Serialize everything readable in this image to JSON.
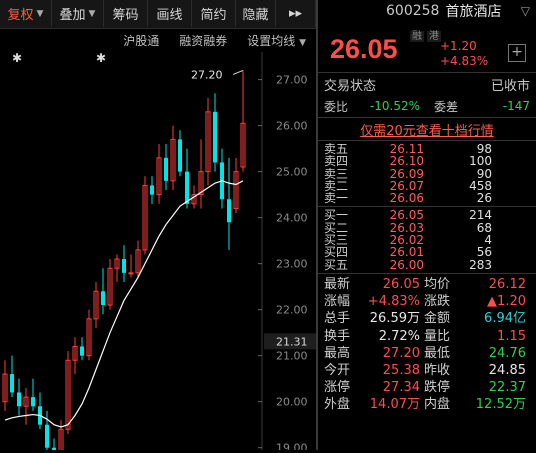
{
  "toolbar": {
    "items": [
      {
        "label": "复权",
        "dropdown": true,
        "active": true
      },
      {
        "label": "叠加",
        "dropdown": true
      },
      {
        "label": "筹码"
      },
      {
        "label": "画线"
      },
      {
        "label": "简约"
      },
      {
        "label": "隐藏"
      },
      {
        "label": "▸▸"
      }
    ]
  },
  "subtoolbar": {
    "hgt": "沪股通",
    "margin": "融资融券",
    "ma": "设置均线"
  },
  "chart": {
    "markers": [
      "✱",
      "✱"
    ],
    "high_label": "27.20",
    "current_tag": "21.31",
    "axis_labels": [
      "27.00",
      "26.00",
      "25.00",
      "24.00",
      "23.00",
      "22.00",
      "21.00",
      "20.00",
      "19.00"
    ],
    "candles": [
      {
        "o": 20.0,
        "h": 20.9,
        "l": 19.8,
        "c": 20.6
      },
      {
        "o": 20.6,
        "h": 21.0,
        "l": 20.1,
        "c": 20.2
      },
      {
        "o": 20.2,
        "h": 20.5,
        "l": 19.7,
        "c": 19.9
      },
      {
        "o": 19.9,
        "h": 20.3,
        "l": 19.5,
        "c": 20.1
      },
      {
        "o": 20.1,
        "h": 20.5,
        "l": 19.8,
        "c": 19.9
      },
      {
        "o": 19.9,
        "h": 20.2,
        "l": 19.4,
        "c": 19.5
      },
      {
        "o": 19.5,
        "h": 19.8,
        "l": 18.8,
        "c": 19.0
      },
      {
        "o": 19.0,
        "h": 19.2,
        "l": 18.7,
        "c": 18.9
      },
      {
        "o": 18.9,
        "h": 19.6,
        "l": 18.8,
        "c": 19.4
      },
      {
        "o": 19.4,
        "h": 21.1,
        "l": 19.3,
        "c": 20.9
      },
      {
        "o": 20.9,
        "h": 21.4,
        "l": 20.6,
        "c": 21.2
      },
      {
        "o": 21.2,
        "h": 21.4,
        "l": 20.9,
        "c": 21.0
      },
      {
        "o": 21.0,
        "h": 22.0,
        "l": 20.9,
        "c": 21.8
      },
      {
        "o": 21.8,
        "h": 22.6,
        "l": 21.6,
        "c": 22.4
      },
      {
        "o": 22.4,
        "h": 22.9,
        "l": 21.9,
        "c": 22.1
      },
      {
        "o": 22.1,
        "h": 23.1,
        "l": 22.0,
        "c": 22.9
      },
      {
        "o": 22.9,
        "h": 23.2,
        "l": 22.6,
        "c": 23.1
      },
      {
        "o": 23.1,
        "h": 23.4,
        "l": 22.6,
        "c": 22.8
      },
      {
        "o": 22.8,
        "h": 23.2,
        "l": 22.7,
        "c": 22.8
      },
      {
        "o": 22.8,
        "h": 23.5,
        "l": 22.7,
        "c": 23.3
      },
      {
        "o": 23.3,
        "h": 24.9,
        "l": 23.2,
        "c": 24.7
      },
      {
        "o": 24.7,
        "h": 24.9,
        "l": 24.3,
        "c": 24.5
      },
      {
        "o": 24.5,
        "h": 25.6,
        "l": 24.3,
        "c": 25.3
      },
      {
        "o": 25.3,
        "h": 25.6,
        "l": 24.6,
        "c": 24.8
      },
      {
        "o": 24.8,
        "h": 26.0,
        "l": 24.6,
        "c": 25.7
      },
      {
        "o": 25.7,
        "h": 25.9,
        "l": 24.9,
        "c": 25.0
      },
      {
        "o": 25.0,
        "h": 25.5,
        "l": 24.2,
        "c": 24.3
      },
      {
        "o": 24.3,
        "h": 24.7,
        "l": 24.2,
        "c": 24.5
      },
      {
        "o": 24.5,
        "h": 25.7,
        "l": 24.2,
        "c": 25.0
      },
      {
        "o": 25.0,
        "h": 26.6,
        "l": 24.7,
        "c": 26.3
      },
      {
        "o": 26.3,
        "h": 26.7,
        "l": 25.0,
        "c": 25.2
      },
      {
        "o": 25.2,
        "h": 25.5,
        "l": 24.2,
        "c": 24.4
      },
      {
        "o": 24.4,
        "h": 25.3,
        "l": 23.3,
        "c": 23.9
      },
      {
        "o": 24.2,
        "h": 25.3,
        "l": 24.1,
        "c": 25.0
      },
      {
        "o": 25.1,
        "h": 27.2,
        "l": 25.0,
        "c": 26.05
      }
    ],
    "ma": [
      19.6,
      19.65,
      19.68,
      19.7,
      19.72,
      19.7,
      19.62,
      19.5,
      19.45,
      19.5,
      19.7,
      19.95,
      20.3,
      20.7,
      21.1,
      21.5,
      21.85,
      22.2,
      22.45,
      22.7,
      23.0,
      23.3,
      23.6,
      23.85,
      24.05,
      24.25,
      24.35,
      24.45,
      24.55,
      24.65,
      24.75,
      24.8,
      24.75,
      24.72,
      24.8
    ]
  },
  "quote": {
    "code": "600258",
    "name": "首旅酒店",
    "price": "26.05",
    "change": "+1.20",
    "pct": "+4.83%",
    "tags": [
      "融",
      "港"
    ],
    "status_label": "交易状态",
    "status_value": "已收市",
    "weibi_label": "委比",
    "weibi_value": "-10.52%",
    "weicha_label": "委差",
    "weicha_value": "-147",
    "promo": "仅需20元查看十档行情"
  },
  "asks": [
    {
      "label": "卖五",
      "price": "26.11",
      "vol": "98"
    },
    {
      "label": "卖四",
      "price": "26.10",
      "vol": "100"
    },
    {
      "label": "卖三",
      "price": "26.09",
      "vol": "90"
    },
    {
      "label": "卖二",
      "price": "26.07",
      "vol": "458"
    },
    {
      "label": "卖一",
      "price": "26.06",
      "vol": "26"
    }
  ],
  "bids": [
    {
      "label": "买一",
      "price": "26.05",
      "vol": "214"
    },
    {
      "label": "买二",
      "price": "26.03",
      "vol": "68"
    },
    {
      "label": "买三",
      "price": "26.02",
      "vol": "4"
    },
    {
      "label": "买四",
      "price": "26.01",
      "vol": "56"
    },
    {
      "label": "买五",
      "price": "26.00",
      "vol": "283"
    }
  ],
  "stats": [
    {
      "l1": "最新",
      "v1": "26.05",
      "c1": "red",
      "l2": "均价",
      "v2": "26.12",
      "c2": "red"
    },
    {
      "l1": "涨幅",
      "v1": "+4.83%",
      "c1": "red",
      "l2": "涨跌",
      "v2": "▲1.20",
      "c2": "red"
    },
    {
      "l1": "总手",
      "v1": "26.59万",
      "c1": "white",
      "l2": "金额",
      "v2": "6.94亿",
      "c2": "cyan"
    },
    {
      "l1": "换手",
      "v1": "2.72%",
      "c1": "white",
      "l2": "量比",
      "v2": "1.15",
      "c2": "red"
    },
    {
      "l1": "最高",
      "v1": "27.20",
      "c1": "red",
      "l2": "最低",
      "v2": "24.76",
      "c2": "green"
    },
    {
      "l1": "今开",
      "v1": "25.38",
      "c1": "red",
      "l2": "昨收",
      "v2": "24.85",
      "c2": "white"
    },
    {
      "l1": "涨停",
      "v1": "27.34",
      "c1": "red",
      "l2": "跌停",
      "v2": "22.37",
      "c2": "green"
    },
    {
      "l1": "外盘",
      "v1": "14.07万",
      "c1": "red",
      "l2": "内盘",
      "v2": "12.52万",
      "c2": "green"
    }
  ]
}
